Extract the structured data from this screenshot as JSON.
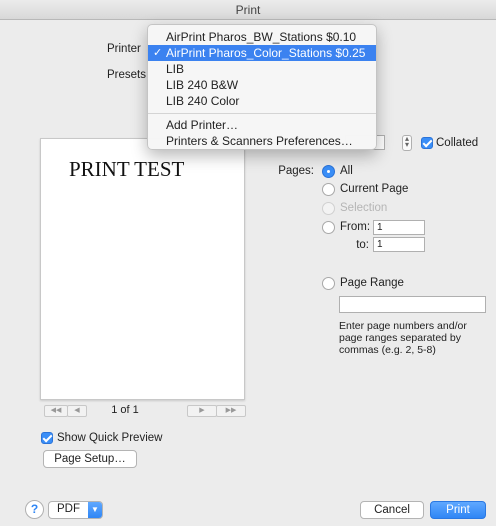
{
  "window": {
    "title": "Print"
  },
  "printer": {
    "label": "Printer",
    "menu": [
      {
        "label": "AirPrint Pharos_BW_Stations $0.10",
        "selected": false
      },
      {
        "label": "AirPrint Pharos_Color_Stations $0.25",
        "selected": true
      },
      {
        "label": "LIB",
        "selected": false
      },
      {
        "label": "LIB 240 B&W",
        "selected": false
      },
      {
        "label": "LIB 240 Color",
        "selected": false
      }
    ],
    "add_printer": "Add Printer…",
    "preferences": "Printers & Scanners Preferences…",
    "check_icon": "✓"
  },
  "presets": {
    "label": "Presets"
  },
  "copies": {
    "collated_label": "Collated",
    "collated": true
  },
  "preview": {
    "text": "PRINT TEST",
    "page_count": "1 of 1",
    "show_quick_preview_label": "Show Quick Preview",
    "show_quick_preview": true,
    "page_setup_label": "Page Setup…"
  },
  "pages": {
    "label": "Pages:",
    "all_label": "All",
    "current_label": "Current Page",
    "selection_label": "Selection",
    "from_label": "From:",
    "from_value": "1",
    "to_label": "to:",
    "to_value": "1",
    "range_label": "Page Range",
    "range_value": "",
    "range_help": "Enter page numbers and/or page ranges separated by commas (e.g. 2, 5-8)"
  },
  "footer": {
    "help_label": "?",
    "pdf_label": "PDF",
    "cancel_label": "Cancel",
    "print_label": "Print"
  },
  "colors": {
    "accent": "#3a8ef7",
    "menu_selected": "#3b82f0"
  }
}
